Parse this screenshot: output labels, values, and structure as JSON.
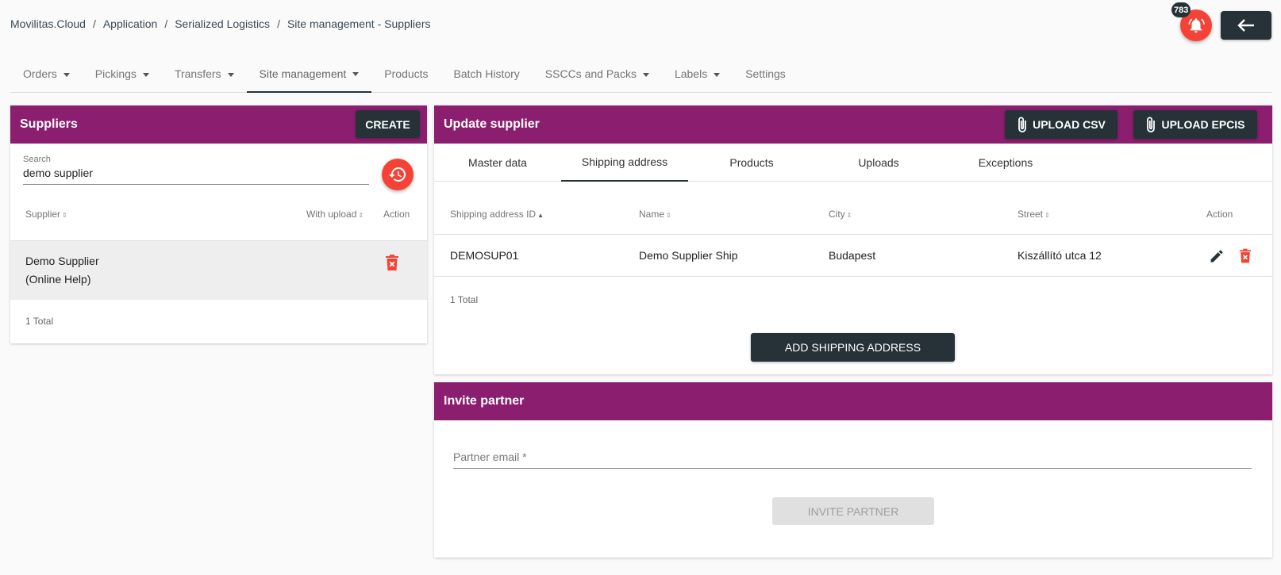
{
  "breadcrumb": [
    "Movilitas.Cloud",
    "Application",
    "Serialized Logistics",
    "Site management - Suppliers"
  ],
  "notifications": {
    "count": "783"
  },
  "nav": {
    "tabs": [
      {
        "label": "Orders",
        "dropdown": true
      },
      {
        "label": "Pickings",
        "dropdown": true
      },
      {
        "label": "Transfers",
        "dropdown": true
      },
      {
        "label": "Site management",
        "dropdown": true,
        "active": true
      },
      {
        "label": "Products",
        "dropdown": false
      },
      {
        "label": "Batch History",
        "dropdown": false
      },
      {
        "label": "SSCCs and Packs",
        "dropdown": true
      },
      {
        "label": "Labels",
        "dropdown": true
      },
      {
        "label": "Settings",
        "dropdown": false
      }
    ]
  },
  "suppliers": {
    "title": "Suppliers",
    "create_label": "CREATE",
    "search_label": "Search",
    "search_value": "demo supplier",
    "columns": {
      "supplier": "Supplier",
      "with_upload": "With upload",
      "action": "Action"
    },
    "rows": [
      {
        "line1": "Demo Supplier",
        "line2": "(Online Help)"
      }
    ],
    "total": "1 Total"
  },
  "update": {
    "title": "Update supplier",
    "upload_csv": "UPLOAD CSV",
    "upload_epcis": "UPLOAD EPCIS",
    "tabs": [
      "Master data",
      "Shipping address",
      "Products",
      "Uploads",
      "Exceptions"
    ],
    "columns": {
      "id": "Shipping address ID",
      "name": "Name",
      "city": "City",
      "street": "Street",
      "action": "Action"
    },
    "rows": [
      {
        "id": "DEMOSUP01",
        "name": "Demo Supplier Ship",
        "city": "Budapest",
        "street": "Kiszállító utca 12"
      }
    ],
    "total": "1 Total",
    "add_label": "ADD SHIPPING ADDRESS"
  },
  "invite": {
    "title": "Invite partner",
    "email_placeholder": "Partner email *",
    "button_label": "INVITE PARTNER"
  },
  "colors": {
    "brand": "#8b1e6f",
    "dark": "#263238",
    "danger": "#f44336"
  }
}
